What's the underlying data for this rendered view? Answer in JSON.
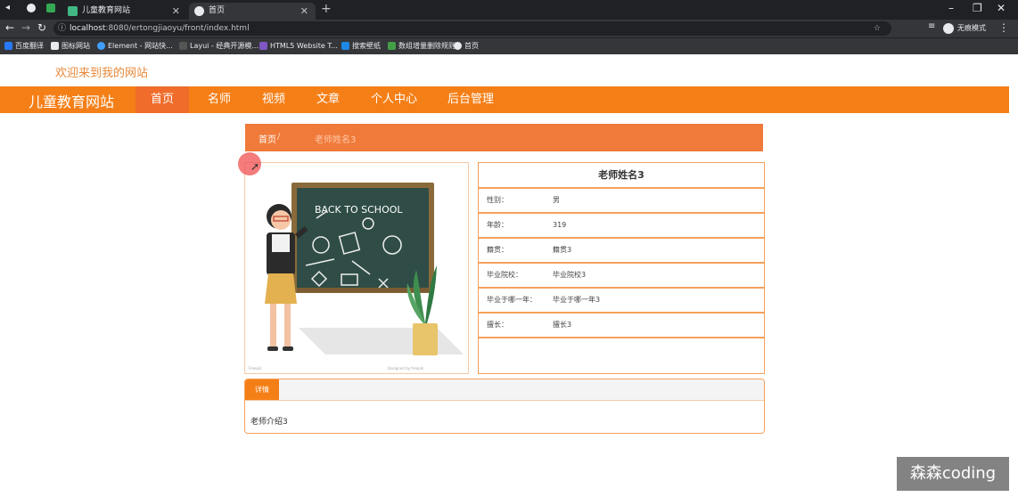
{
  "browser": {
    "tabs": [
      {
        "title": "儿童教育网站",
        "active": false
      },
      {
        "title": "首页",
        "active": true
      }
    ],
    "url_host": "localhost",
    "url_rest": ":8080/ertongjiaoyu/front/index.html",
    "profile_label": "无痕模式",
    "bookmarks": [
      "百度翻译",
      "图标网站",
      "Element - 网站快...",
      "Layui - 经典开源模...",
      "HTML5 Website T...",
      "搜索壁纸",
      "数组增量删除规则",
      "首页"
    ]
  },
  "site": {
    "welcome": "欢迎来到我的网站",
    "brand": "儿童教育网站",
    "nav": [
      "首页",
      "名师",
      "视频",
      "文章",
      "个人中心",
      "后台管理"
    ],
    "active_nav": "首页"
  },
  "breadcrumb": {
    "home": "首页",
    "current": "老师姓名3"
  },
  "image": {
    "board_text": "BACK TO SCHOOL",
    "caption_left": "Freepik",
    "caption_right": "Designed by freepik"
  },
  "teacher": {
    "name": "老师姓名3",
    "fields": [
      {
        "label": "性别：",
        "value": "男"
      },
      {
        "label": "年龄：",
        "value": "319"
      },
      {
        "label": "籍贯：",
        "value": "籍贯3"
      },
      {
        "label": "毕业院校：",
        "value": "毕业院校3"
      },
      {
        "label": "毕业于哪一年：",
        "value": "毕业于哪一年3"
      },
      {
        "label": "擅长：",
        "value": "擅长3"
      }
    ]
  },
  "detail": {
    "tab": "详情",
    "intro": "老师介绍3"
  },
  "watermark": "森森coding",
  "colors": {
    "accent": "#f57f17",
    "breadcrumb": "#f07a3a",
    "border": "#f5a05a"
  }
}
